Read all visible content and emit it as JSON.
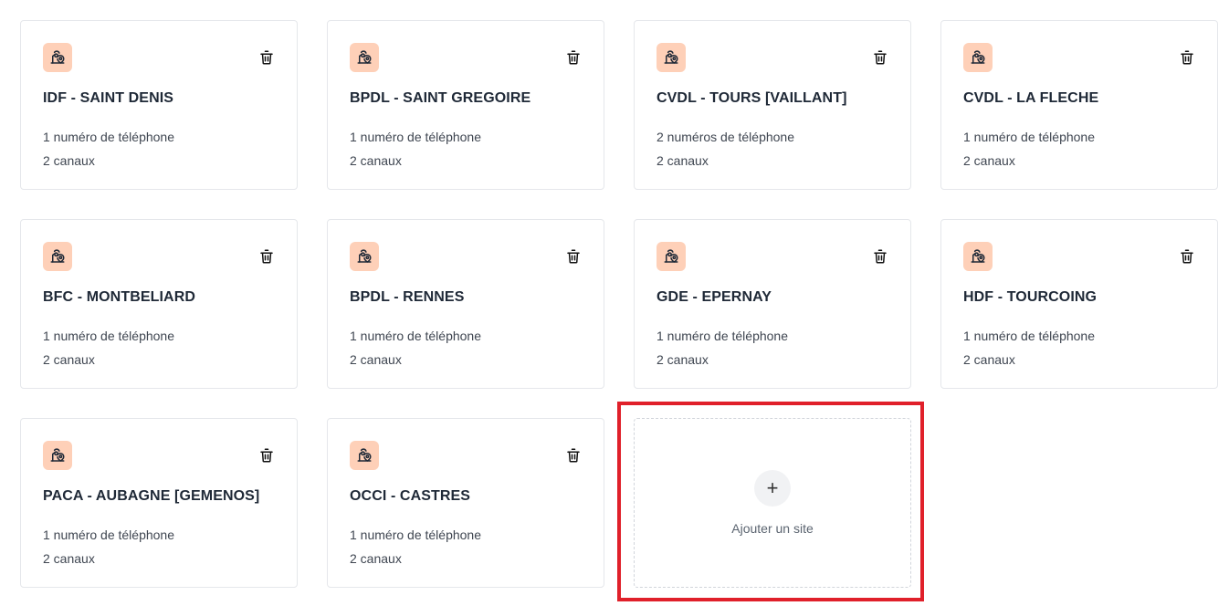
{
  "sites": [
    {
      "name": "IDF - SAINT DENIS",
      "phones": "1 numéro de téléphone",
      "channels": "2 canaux"
    },
    {
      "name": "BPDL - SAINT GREGOIRE",
      "phones": "1 numéro de téléphone",
      "channels": "2 canaux"
    },
    {
      "name": "CVDL - TOURS [VAILLANT]",
      "phones": "2 numéros de téléphone",
      "channels": "2 canaux"
    },
    {
      "name": "CVDL - LA FLECHE",
      "phones": "1 numéro de téléphone",
      "channels": "2 canaux"
    },
    {
      "name": "BFC - MONTBELIARD",
      "phones": "1 numéro de téléphone",
      "channels": "2 canaux"
    },
    {
      "name": "BPDL - RENNES",
      "phones": "1 numéro de téléphone",
      "channels": "2 canaux"
    },
    {
      "name": "GDE - EPERNAY",
      "phones": "1 numéro de téléphone",
      "channels": "2 canaux"
    },
    {
      "name": "HDF - TOURCOING",
      "phones": "1 numéro de téléphone",
      "channels": "2 canaux"
    },
    {
      "name": "PACA - AUBAGNE [GEMENOS]",
      "phones": "1 numéro de téléphone",
      "channels": "2 canaux"
    },
    {
      "name": "OCCI - CASTRES",
      "phones": "1 numéro de téléphone",
      "channels": "2 canaux"
    }
  ],
  "add_site": {
    "icon": "plus-icon",
    "label": "Ajouter un site"
  },
  "icons": {
    "site": "map-pin-home-icon",
    "delete": "trash-icon"
  },
  "colors": {
    "icon_bg": "#fed0b8",
    "icon_fg": "#1f2937",
    "highlight": "#e0202a"
  }
}
